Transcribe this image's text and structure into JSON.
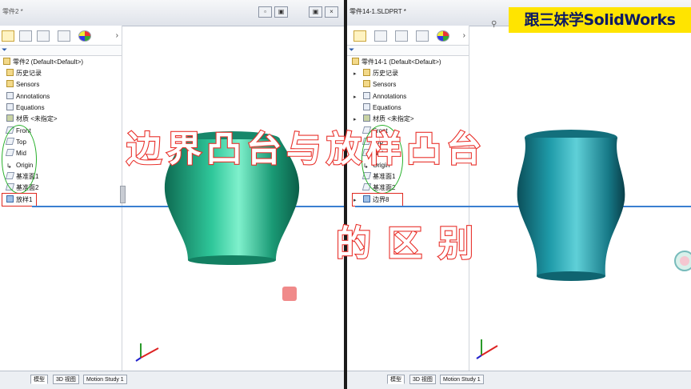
{
  "left_window": {
    "title": "零件2 *",
    "win_buttons": [
      "▫",
      "▣",
      "×"
    ],
    "tabs_icons": [
      "feature-manager-icon",
      "property-manager-icon",
      "configuration-manager-icon",
      "dimxpert-icon",
      "display-manager-icon"
    ],
    "more_chevron": "›",
    "root": "零件2  (Default<Default>)",
    "nodes": [
      "历史记录",
      "Sensors",
      "Annotations",
      "Equations",
      "材质 <未指定>",
      "Front",
      "Top",
      "Mid",
      "Origin",
      "基准面1",
      "基准面2",
      "放样1"
    ],
    "bottom_tabs": [
      "模型",
      "3D 视图",
      "Motion Study 1"
    ]
  },
  "right_window": {
    "title": "零件14-1.SLDPRT *",
    "tabs_icons": [
      "feature-manager-icon",
      "property-manager-icon",
      "configuration-manager-icon",
      "dimxpert-icon",
      "display-manager-icon"
    ],
    "more_chevron": "›",
    "root": "零件14-1  (Default<Default>)",
    "nodes": [
      "历史记录",
      "Sensors",
      "Annotations",
      "Equations",
      "材质 <未指定>",
      "Front",
      "Top",
      "Mid",
      "Origin",
      "基准面1",
      "基准面2",
      "边界8"
    ],
    "bottom_tabs": [
      "模型",
      "3D 视图",
      "Motion Study 1"
    ]
  },
  "overlay": {
    "title_line1": "边界凸台与放样凸台",
    "title_line2": "的区别"
  },
  "watermark": "跟三妹学SolidWorks",
  "colors": {
    "left_vase": "#1f9e7a",
    "right_vase": "#187f8e",
    "highlight_box": "#e0281f",
    "circle_annotation": "#27b02a",
    "overlay_stroke": "#e8302a",
    "watermark_bg": "#ffe400"
  }
}
